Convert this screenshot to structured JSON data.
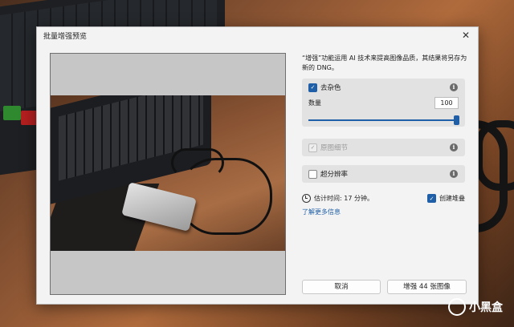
{
  "window": {
    "title": "批量增强预览"
  },
  "description": "“增强”功能运用 AI 技术来提高图像品质，其结果将另存为新的 DNG。",
  "options": {
    "denoise": {
      "label": "去杂色",
      "checked": true
    },
    "amount": {
      "label": "数量",
      "value": "100",
      "slider_fraction": 1.0
    },
    "raw_details": {
      "label": "原图细节",
      "checked": true,
      "disabled": true
    },
    "super_resolution": {
      "label": "超分辨率",
      "checked": false
    }
  },
  "estimate": {
    "text": "估计时间: 17 分钟。"
  },
  "create_stack": {
    "label": "创建堆叠",
    "checked": true
  },
  "learn_more": "了解更多信息",
  "buttons": {
    "cancel": "取消",
    "enhance": "增强 44 张图像"
  },
  "watermark": "小黑盒",
  "icons": {
    "close": "close-icon",
    "info": "info-icon",
    "clock": "clock-icon",
    "check": "check-icon"
  },
  "colors": {
    "accent": "#1e5fa8",
    "dialog_bg": "#f3f3f3",
    "panel_bg": "#e2e2e2"
  }
}
